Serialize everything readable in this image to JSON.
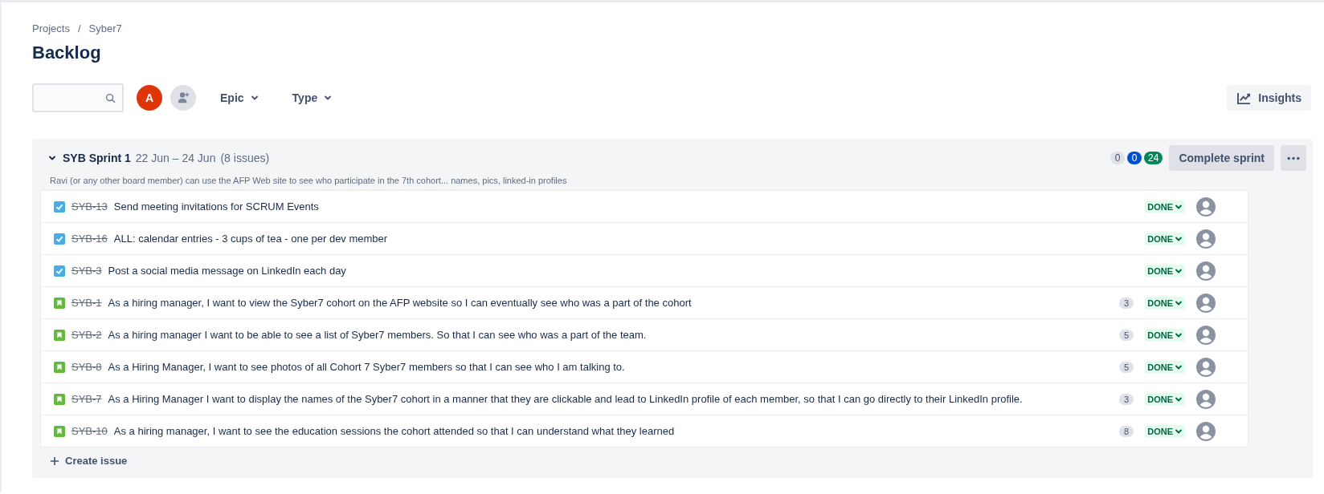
{
  "breadcrumbs": {
    "items": [
      "Projects",
      "Syber7"
    ],
    "separator": "/"
  },
  "title": "Backlog",
  "toolbar": {
    "avatar": {
      "initial": "A"
    },
    "filters": [
      "Epic",
      "Type"
    ],
    "insights": "Insights"
  },
  "sprint": {
    "name": "SYB Sprint 1",
    "expanded": true,
    "dates": "22 Jun – 24 Jun",
    "count": "(8 issues)",
    "goal": "Ravi (or any other board member) can use the AFP Web site to see who participate in the 7th cohort... names, pics, linked-in profiles",
    "totals": [
      {
        "value": "0",
        "kind": "todo"
      },
      {
        "value": "0",
        "kind": "progress"
      },
      {
        "value": "24",
        "kind": "done"
      }
    ],
    "complete_button": "Complete sprint",
    "issues": [
      {
        "kind": "task",
        "key": "SYB-13",
        "resolved": true,
        "summary": "Send meeting invitations for SCRUM Events",
        "status": "DONE"
      },
      {
        "kind": "task",
        "key": "SYB-16",
        "resolved": true,
        "summary": "ALL: calendar entries - 3 cups of tea - one per dev member",
        "status": "DONE"
      },
      {
        "kind": "task",
        "key": "SYB-3",
        "resolved": true,
        "summary": "Post a social media message on LinkedIn each day",
        "status": "DONE"
      },
      {
        "kind": "story",
        "key": "SYB-1",
        "resolved": true,
        "summary": "As a hiring manager, I want to view the Syber7 cohort on the AFP website so I can eventually see who was a part of the cohort",
        "points": "3",
        "status": "DONE"
      },
      {
        "kind": "story",
        "key": "SYB-2",
        "resolved": true,
        "summary": "As a hiring manager I want to be able to see a list of Syber7 members. So that I can see who was a part of the team.",
        "points": "5",
        "status": "DONE"
      },
      {
        "kind": "story",
        "key": "SYB-8",
        "resolved": true,
        "summary": "As a Hiring Manager, I want to see photos of all Cohort 7 Syber7 members so that I can see who I am talking to.",
        "points": "5",
        "status": "DONE"
      },
      {
        "kind": "story",
        "key": "SYB-7",
        "resolved": true,
        "summary": "As a Hiring Manager I want to display the names of the Syber7 cohort in a manner that they are clickable and lead to LinkedIn profile of each member, so that I can go directly to their LinkedIn profile.",
        "points": "3",
        "status": "DONE"
      },
      {
        "kind": "story",
        "key": "SYB-10",
        "resolved": true,
        "summary": "As a hiring manager, I want to see the education sessions the cohort attended so that I can understand what they learned",
        "points": "8",
        "status": "DONE"
      }
    ],
    "create_issue": "Create issue"
  }
}
